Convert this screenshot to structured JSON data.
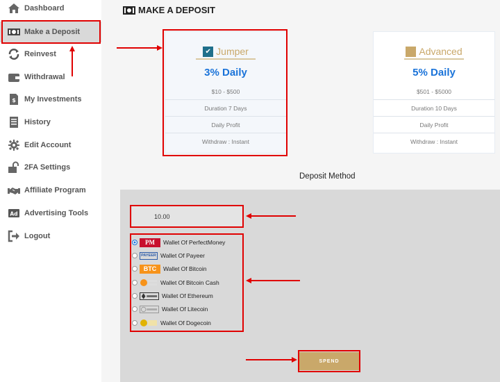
{
  "sidebar": {
    "items": [
      {
        "label": "Dashboard",
        "icon": "home-icon"
      },
      {
        "label": "Make a Deposit",
        "icon": "money-icon",
        "active": true
      },
      {
        "label": "Reinvest",
        "icon": "refresh-icon"
      },
      {
        "label": "Withdrawal",
        "icon": "wallet-icon"
      },
      {
        "label": "My Investments",
        "icon": "investment-icon"
      },
      {
        "label": "History",
        "icon": "history-icon"
      },
      {
        "label": "Edit Account",
        "icon": "gear-icon"
      },
      {
        "label": "2FA Settings",
        "icon": "lock-icon"
      },
      {
        "label": "Affiliate Program",
        "icon": "handshake-icon"
      },
      {
        "label": "Advertising Tools",
        "icon": "ad-icon"
      },
      {
        "label": "Logout",
        "icon": "logout-icon"
      }
    ]
  },
  "page": {
    "title": "MAKE A DEPOSIT"
  },
  "plans": [
    {
      "name": "Jumper",
      "rate": "3% Daily",
      "range": "$10 - $500",
      "duration": "Duration 7 Days",
      "profit": "Daily Profit",
      "withdraw": "Withdraw : Instant",
      "selected": true
    },
    {
      "name": "Advanced",
      "rate": "5% Daily",
      "range": "$501 - $5000",
      "duration": "Duration 10 Days",
      "profit": "Daily Profit",
      "withdraw": "Withdraw : Instant",
      "selected": false
    }
  ],
  "deposit": {
    "method_label": "Deposit Method",
    "amount": "10.00",
    "methods": [
      {
        "label": "Wallet Of PerfectMoney",
        "logo": "PM",
        "checked": true
      },
      {
        "label": "Wallet Of Payeer",
        "logo": "PAYEER",
        "checked": false
      },
      {
        "label": "Wallet Of Bitcoin",
        "logo": "BTC",
        "checked": false
      },
      {
        "label": "Wallet Of Bitcoin Cash",
        "logo": "bitcoin-cash-logo",
        "checked": false
      },
      {
        "label": "Wallet Of Ethereum",
        "logo": "ethereum-logo",
        "checked": false
      },
      {
        "label": "Wallet Of Litecoin",
        "logo": "litecoin-logo",
        "checked": false
      },
      {
        "label": "Wallet Of Dogecoin",
        "logo": "dogecoin-logo",
        "checked": false
      }
    ],
    "spend_label": "SPEND"
  },
  "colors": {
    "accent_gold": "#c9a86a",
    "rate_blue": "#1a73d9",
    "annotation_red": "#e00000",
    "sidebar_active": "#d9d9d9"
  }
}
